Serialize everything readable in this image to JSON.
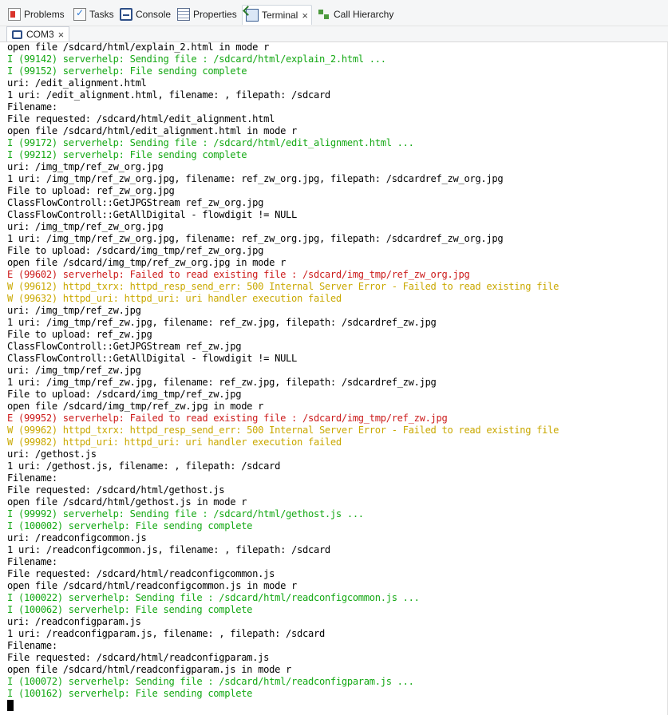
{
  "view_tabs": [
    {
      "label": "Problems",
      "icon": "problems-icon"
    },
    {
      "label": "Tasks",
      "icon": "tasks-icon"
    },
    {
      "label": "Console",
      "icon": "console-icon"
    },
    {
      "label": "Properties",
      "icon": "properties-icon"
    },
    {
      "label": "Terminal",
      "icon": "terminal-icon",
      "close": "×"
    },
    {
      "label": "Call Hierarchy",
      "icon": "call-hierarchy-icon"
    }
  ],
  "session": {
    "label": "COM3",
    "close": "×"
  },
  "colors": {
    "normal": "#000000",
    "info": "#14a814",
    "error": "#cc1b1b",
    "warning": "#c9a800"
  },
  "lines": [
    {
      "level": "normal",
      "text": "open file /sdcard/html/explain_2.html in mode r"
    },
    {
      "level": "info",
      "text": "I (99142) serverhelp: Sending file : /sdcard/html/explain_2.html ..."
    },
    {
      "level": "info",
      "text": "I (99152) serverhelp: File sending complete"
    },
    {
      "level": "normal",
      "text": "uri: /edit_alignment.html"
    },
    {
      "level": "normal",
      "text": "1 uri: /edit_alignment.html, filename: , filepath: /sdcard"
    },
    {
      "level": "normal",
      "text": "Filename:"
    },
    {
      "level": "normal",
      "text": "File requested: /sdcard/html/edit_alignment.html"
    },
    {
      "level": "normal",
      "text": "open file /sdcard/html/edit_alignment.html in mode r"
    },
    {
      "level": "info",
      "text": "I (99172) serverhelp: Sending file : /sdcard/html/edit_alignment.html ..."
    },
    {
      "level": "info",
      "text": "I (99212) serverhelp: File sending complete"
    },
    {
      "level": "normal",
      "text": "uri: /img_tmp/ref_zw_org.jpg"
    },
    {
      "level": "normal",
      "text": "1 uri: /img_tmp/ref_zw_org.jpg, filename: ref_zw_org.jpg, filepath: /sdcardref_zw_org.jpg"
    },
    {
      "level": "normal",
      "text": "File to upload: ref_zw_org.jpg"
    },
    {
      "level": "normal",
      "text": "ClassFlowControll::GetJPGStream ref_zw_org.jpg"
    },
    {
      "level": "normal",
      "text": "ClassFlowControll::GetAllDigital - flowdigit != NULL"
    },
    {
      "level": "normal",
      "text": "uri: /img_tmp/ref_zw_org.jpg"
    },
    {
      "level": "normal",
      "text": "1 uri: /img_tmp/ref_zw_org.jpg, filename: ref_zw_org.jpg, filepath: /sdcardref_zw_org.jpg"
    },
    {
      "level": "normal",
      "text": "File to upload: /sdcard/img_tmp/ref_zw_org.jpg"
    },
    {
      "level": "normal",
      "text": "open file /sdcard/img_tmp/ref_zw_org.jpg in mode r"
    },
    {
      "level": "error",
      "text": "E (99602) serverhelp: Failed to read existing file : /sdcard/img_tmp/ref_zw_org.jpg"
    },
    {
      "level": "warning",
      "text": "W (99612) httpd_txrx: httpd_resp_send_err: 500 Internal Server Error - Failed to read existing file"
    },
    {
      "level": "warning",
      "text": "W (99632) httpd_uri: httpd_uri: uri handler execution failed"
    },
    {
      "level": "normal",
      "text": "uri: /img_tmp/ref_zw.jpg"
    },
    {
      "level": "normal",
      "text": "1 uri: /img_tmp/ref_zw.jpg, filename: ref_zw.jpg, filepath: /sdcardref_zw.jpg"
    },
    {
      "level": "normal",
      "text": "File to upload: ref_zw.jpg"
    },
    {
      "level": "normal",
      "text": "ClassFlowControll::GetJPGStream ref_zw.jpg"
    },
    {
      "level": "normal",
      "text": "ClassFlowControll::GetAllDigital - flowdigit != NULL"
    },
    {
      "level": "normal",
      "text": "uri: /img_tmp/ref_zw.jpg"
    },
    {
      "level": "normal",
      "text": "1 uri: /img_tmp/ref_zw.jpg, filename: ref_zw.jpg, filepath: /sdcardref_zw.jpg"
    },
    {
      "level": "normal",
      "text": "File to upload: /sdcard/img_tmp/ref_zw.jpg"
    },
    {
      "level": "normal",
      "text": "open file /sdcard/img_tmp/ref_zw.jpg in mode r"
    },
    {
      "level": "error",
      "text": "E (99952) serverhelp: Failed to read existing file : /sdcard/img_tmp/ref_zw.jpg"
    },
    {
      "level": "warning",
      "text": "W (99962) httpd_txrx: httpd_resp_send_err: 500 Internal Server Error - Failed to read existing file"
    },
    {
      "level": "warning",
      "text": "W (99982) httpd_uri: httpd_uri: uri handler execution failed"
    },
    {
      "level": "normal",
      "text": "uri: /gethost.js"
    },
    {
      "level": "normal",
      "text": "1 uri: /gethost.js, filename: , filepath: /sdcard"
    },
    {
      "level": "normal",
      "text": "Filename:"
    },
    {
      "level": "normal",
      "text": "File requested: /sdcard/html/gethost.js"
    },
    {
      "level": "normal",
      "text": "open file /sdcard/html/gethost.js in mode r"
    },
    {
      "level": "info",
      "text": "I (99992) serverhelp: Sending file : /sdcard/html/gethost.js ..."
    },
    {
      "level": "info",
      "text": "I (100002) serverhelp: File sending complete"
    },
    {
      "level": "normal",
      "text": "uri: /readconfigcommon.js"
    },
    {
      "level": "normal",
      "text": "1 uri: /readconfigcommon.js, filename: , filepath: /sdcard"
    },
    {
      "level": "normal",
      "text": "Filename:"
    },
    {
      "level": "normal",
      "text": "File requested: /sdcard/html/readconfigcommon.js"
    },
    {
      "level": "normal",
      "text": "open file /sdcard/html/readconfigcommon.js in mode r"
    },
    {
      "level": "info",
      "text": "I (100022) serverhelp: Sending file : /sdcard/html/readconfigcommon.js ..."
    },
    {
      "level": "info",
      "text": "I (100062) serverhelp: File sending complete"
    },
    {
      "level": "normal",
      "text": "uri: /readconfigparam.js"
    },
    {
      "level": "normal",
      "text": "1 uri: /readconfigparam.js, filename: , filepath: /sdcard"
    },
    {
      "level": "normal",
      "text": "Filename:"
    },
    {
      "level": "normal",
      "text": "File requested: /sdcard/html/readconfigparam.js"
    },
    {
      "level": "normal",
      "text": "open file /sdcard/html/readconfigparam.js in mode r"
    },
    {
      "level": "info",
      "text": "I (100072) serverhelp: Sending file : /sdcard/html/readconfigparam.js ..."
    },
    {
      "level": "info",
      "text": "I (100162) serverhelp: File sending complete"
    }
  ]
}
